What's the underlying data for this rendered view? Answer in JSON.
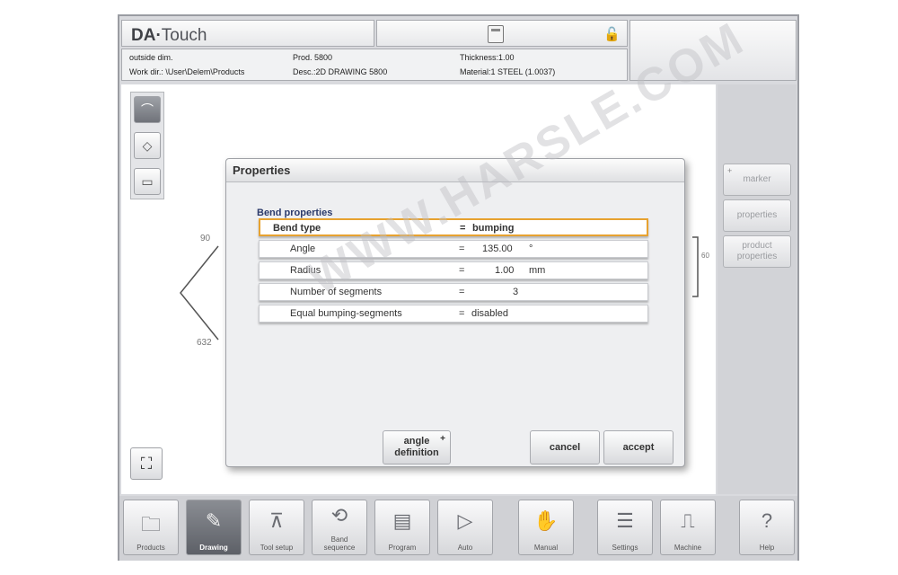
{
  "header": {
    "logo_da": "DA",
    "logo_sep": "·",
    "logo_touch": "Touch",
    "calculator_icon": "calculator-icon",
    "lock_icon": "unlock-icon"
  },
  "info": {
    "outside_dim": "outside dim.",
    "work_dir": "Work dir.: \\User\\Delem\\Products",
    "prod": "Prod. 5800",
    "desc": "Desc.:2D DRAWING 5800",
    "thickness": "Thickness:1.00",
    "material": "Material:1 STEEL (1.0037)"
  },
  "drawing": {
    "dim_top": "90",
    "dim_bottom": "632",
    "dim_right": "60"
  },
  "side_panel": {
    "marker": "marker",
    "properties": "properties",
    "product_properties_1": "product",
    "product_properties_2": "properties",
    "marker_plus": "+"
  },
  "dialog": {
    "title": "Properties",
    "section": "Bend properties",
    "rows": [
      {
        "label": "Bend type",
        "eq": "=",
        "value": "bumping",
        "unit": ""
      },
      {
        "label": "Angle",
        "eq": "=",
        "value": "135.00",
        "unit": "°"
      },
      {
        "label": "Radius",
        "eq": "=",
        "value": "1.00",
        "unit": "mm"
      },
      {
        "label": "Number of segments",
        "eq": "=",
        "value": "3",
        "unit": ""
      },
      {
        "label": "Equal bumping-segments",
        "eq": "=",
        "value": "disabled",
        "unit": ""
      }
    ],
    "btn_angle_1": "angle",
    "btn_angle_2": "definition",
    "btn_angle_plus": "+",
    "btn_cancel": "cancel",
    "btn_accept": "accept"
  },
  "watermark": "WWW.HARSLE.COM",
  "nav": {
    "products": "Products",
    "drawing": "Drawing",
    "tool_setup": "Tool setup",
    "band_sequence_1": "Band",
    "band_sequence_2": "sequence",
    "program": "Program",
    "auto": "Auto",
    "manual": "Manual",
    "settings": "Settings",
    "machine": "Machine",
    "help": "Help"
  }
}
